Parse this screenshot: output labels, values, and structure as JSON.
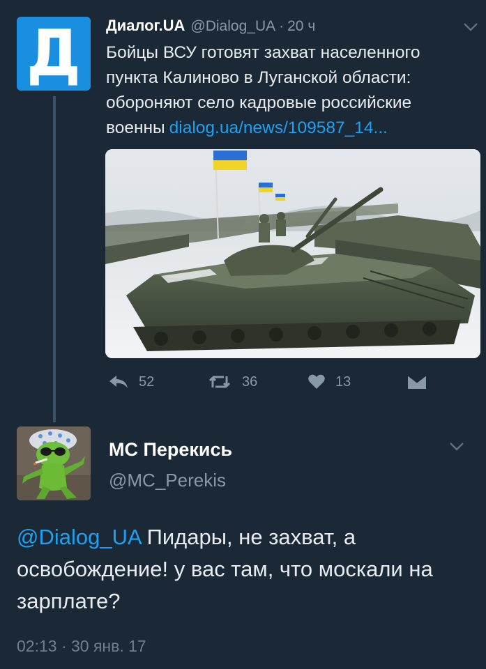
{
  "tweet": {
    "avatar_letter": "Д",
    "author_name": "Диалог.UA",
    "author_handle": "@Dialog_UA",
    "separator": "·",
    "time": "20 ч",
    "text": "Бойцы ВСУ готовят захват населенного пункта Калиново в Луганской области: обороняют село кадровые российские военны",
    "link_text": "dialog.ua/news/109587_14...",
    "actions": {
      "reply_icon": "reply-icon",
      "reply_count": "52",
      "retweet_icon": "retweet-icon",
      "retweet_count": "36",
      "like_icon": "heart-icon",
      "like_count": "13",
      "dm_icon": "direct-message-icon"
    }
  },
  "reply": {
    "author_name": "MC Перекись",
    "author_handle": "@MC_Perekis",
    "mention": "@Dialog_UA",
    "text": " Пидары, не захват, а освобождение! у вас там, что москали на зарплате?",
    "timestamp": "02:13 · 30 янв. 17"
  },
  "colors": {
    "background": "#1b2836",
    "link": "#1da1f2",
    "muted": "#8899a6",
    "dialog_brand": "#1a8fe0"
  }
}
